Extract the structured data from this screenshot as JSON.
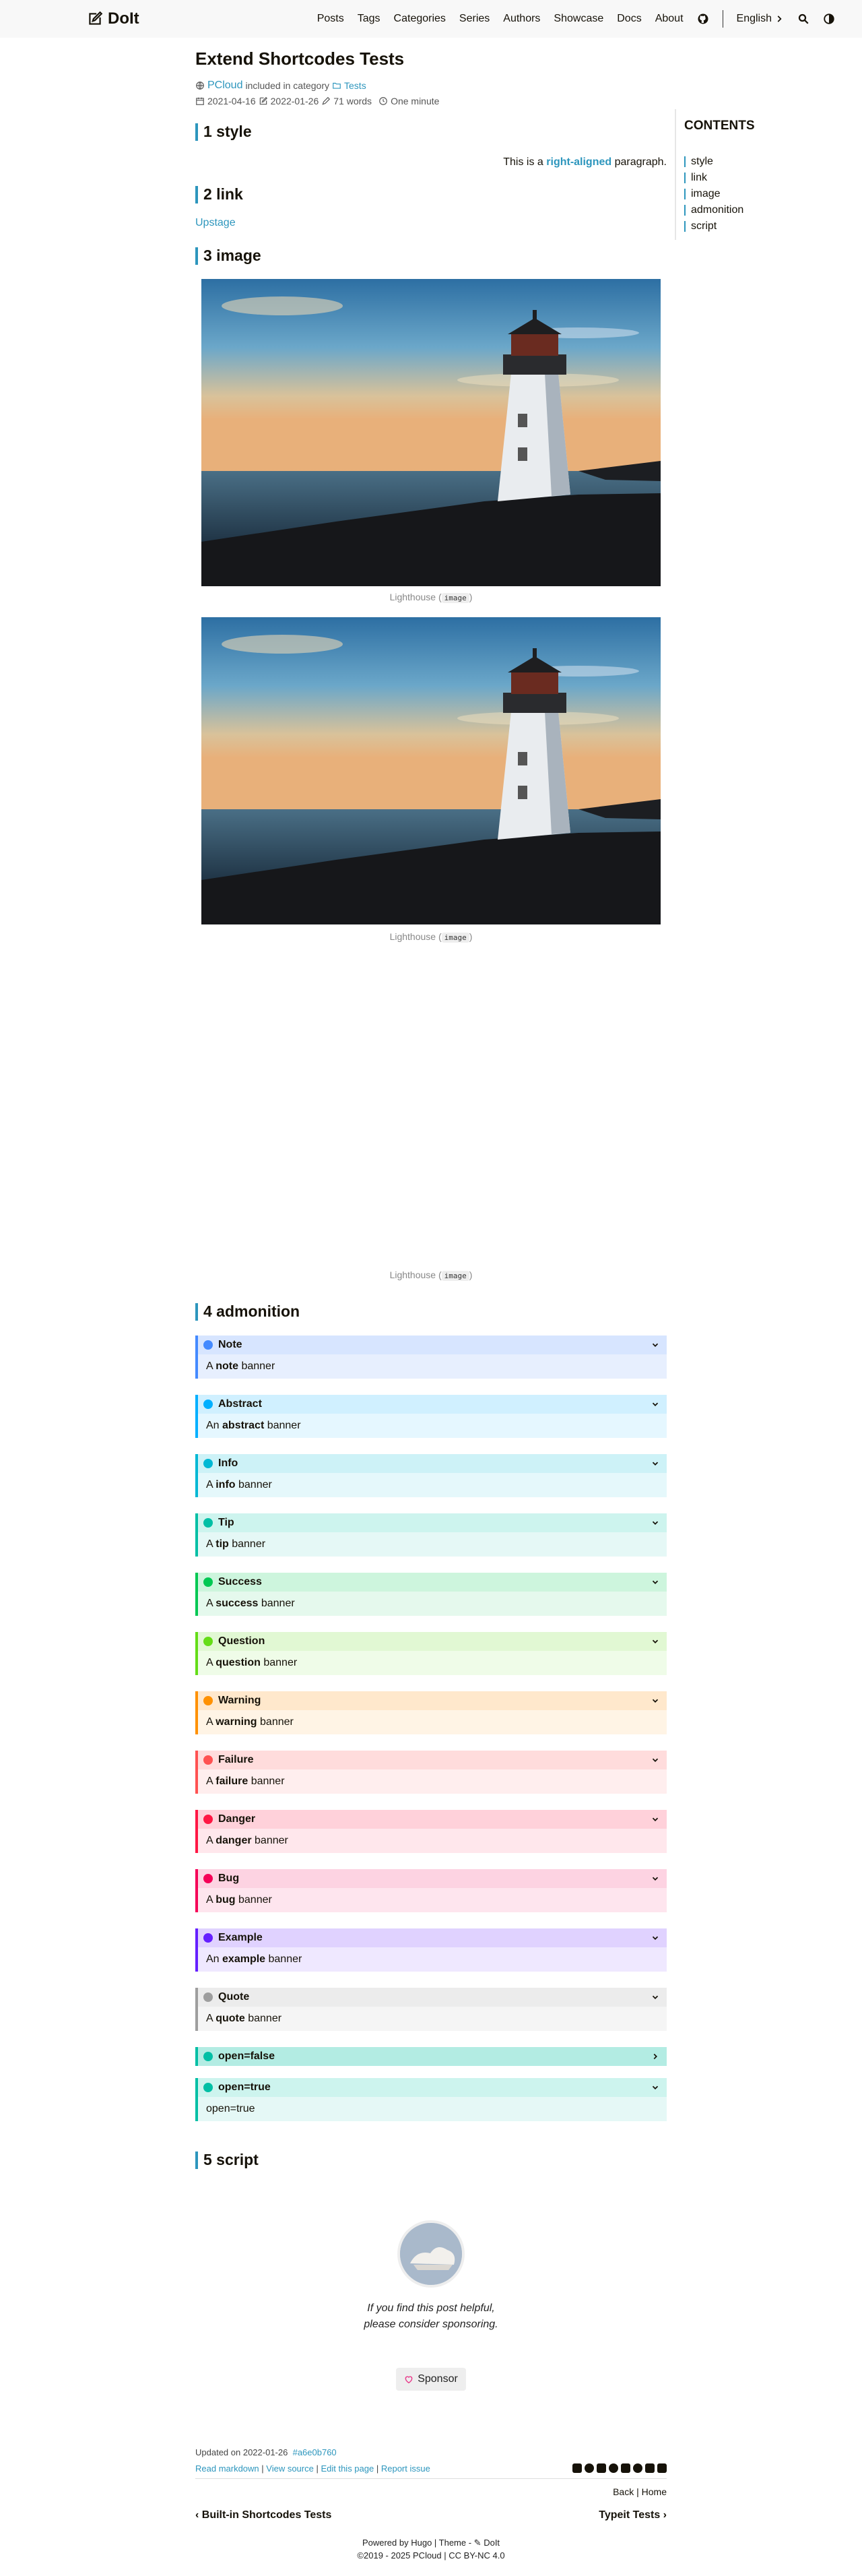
{
  "header": {
    "logo_text": "DoIt",
    "nav": [
      "Posts",
      "Tags",
      "Categories",
      "Series",
      "Authors",
      "Showcase",
      "Docs",
      "About"
    ],
    "language": "English"
  },
  "post": {
    "title": "Extend Shortcodes Tests",
    "author": "PCloud",
    "included_in": "included in category",
    "category": "Tests",
    "published": "2021-04-16",
    "modified": "2022-01-26",
    "words": "71 words",
    "reading_time": "One minute"
  },
  "sections": {
    "style": "1 style",
    "link": "2 link",
    "image": "3 image",
    "admonition": "4 admonition",
    "script": "5 script"
  },
  "style_demo": {
    "before": "This is a ",
    "highlight": "right-aligned",
    "after": " paragraph."
  },
  "link_demo": {
    "text": "Upstage"
  },
  "image_demo": {
    "caption_text": "Lighthouse (",
    "caption_code": "image",
    "caption_close": ")"
  },
  "admonitions": [
    {
      "title": "Note",
      "pre": "A ",
      "bold": "note",
      "post": " banner",
      "color": "#448aff",
      "bg": "#e7effe",
      "headbg": "#d7e5ff",
      "icon": "pencil-icon",
      "open": true
    },
    {
      "title": "Abstract",
      "pre": "An ",
      "bold": "abstract",
      "post": " banner",
      "color": "#00b0ff",
      "bg": "#e5f7ff",
      "headbg": "#d0f0ff",
      "icon": "list-icon",
      "open": true
    },
    {
      "title": "Info",
      "pre": "A ",
      "bold": "info",
      "post": " banner",
      "color": "#00b8d4",
      "bg": "#e5f8fb",
      "headbg": "#cdf2f7",
      "icon": "info-icon",
      "open": true
    },
    {
      "title": "Tip",
      "pre": "A ",
      "bold": "tip",
      "post": " banner",
      "color": "#00bfa5",
      "bg": "#e5f8f6",
      "headbg": "#cdf4ee",
      "icon": "lightbulb-icon",
      "open": true
    },
    {
      "title": "Success",
      "pre": "A ",
      "bold": "success",
      "post": " banner",
      "color": "#00c853",
      "bg": "#e5f9ed",
      "headbg": "#cdf5dd",
      "icon": "check-circle-icon",
      "open": true
    },
    {
      "title": "Question",
      "pre": "A ",
      "bold": "question",
      "post": " banner",
      "color": "#64dd17",
      "bg": "#effce8",
      "headbg": "#e1f8d3",
      "icon": "question-circle-icon",
      "open": true
    },
    {
      "title": "Warning",
      "pre": "A ",
      "bold": "warning",
      "post": " banner",
      "color": "#ff9100",
      "bg": "#fff4e5",
      "headbg": "#ffe8cc",
      "icon": "warning-triangle-icon",
      "open": true
    },
    {
      "title": "Failure",
      "pre": "A ",
      "bold": "failure",
      "post": " banner",
      "color": "#ff5252",
      "bg": "#ffeeee",
      "headbg": "#ffdcdc",
      "icon": "x-circle-icon",
      "open": true
    },
    {
      "title": "Danger",
      "pre": "A ",
      "bold": "danger",
      "post": " banner",
      "color": "#ff1744",
      "bg": "#ffe7ec",
      "headbg": "#ffd1da",
      "icon": "skull-icon",
      "open": true
    },
    {
      "title": "Bug",
      "pre": "A ",
      "bold": "bug",
      "post": " banner",
      "color": "#f50057",
      "bg": "#fee5ee",
      "headbg": "#fdd3e2",
      "icon": "bug-icon",
      "open": true
    },
    {
      "title": "Example",
      "pre": "An ",
      "bold": "example",
      "post": " banner",
      "color": "#651fff",
      "bg": "#efe8ff",
      "headbg": "#e0d2ff",
      "icon": "list-ol-icon",
      "open": true
    },
    {
      "title": "Quote",
      "pre": "A ",
      "bold": "quote",
      "post": " banner",
      "color": "#9e9e9e",
      "bg": "#f5f5f5",
      "headbg": "#ececec",
      "icon": "quote-icon",
      "open": true
    },
    {
      "title": "open=false",
      "pre": "",
      "bold": "",
      "post": "",
      "color": "#00bfa5",
      "bg": "#e5f8f6",
      "headbg": "#b3ece3",
      "icon": "lightbulb-icon",
      "open": false
    },
    {
      "title": "open=true",
      "pre": "open=true",
      "bold": "",
      "post": "",
      "color": "#00bfa5",
      "bg": "#e5f8f6",
      "headbg": "#cdf4ee",
      "icon": "lightbulb-icon",
      "open": true
    }
  ],
  "toc": {
    "title": "CONTENTS",
    "items": [
      "style",
      "link",
      "image",
      "admonition",
      "script"
    ]
  },
  "sponsor": {
    "text": "If you find this post helpful, please consider sponsoring.",
    "button": "Sponsor"
  },
  "footer": {
    "updated_label": "Updated on 2022-01-26",
    "hash": "a6e0b760",
    "links": [
      "Read markdown",
      "View source",
      "Edit this page",
      "Report issue"
    ],
    "back": "Back",
    "home": "Home",
    "prev": "Built-in Shortcodes Tests",
    "next": "Typeit Tests",
    "powered": "Powered by Hugo | Theme - ",
    "theme": "DoIt",
    "copyright": "2019 - 2025 PCloud | CC BY-NC 4.0"
  }
}
